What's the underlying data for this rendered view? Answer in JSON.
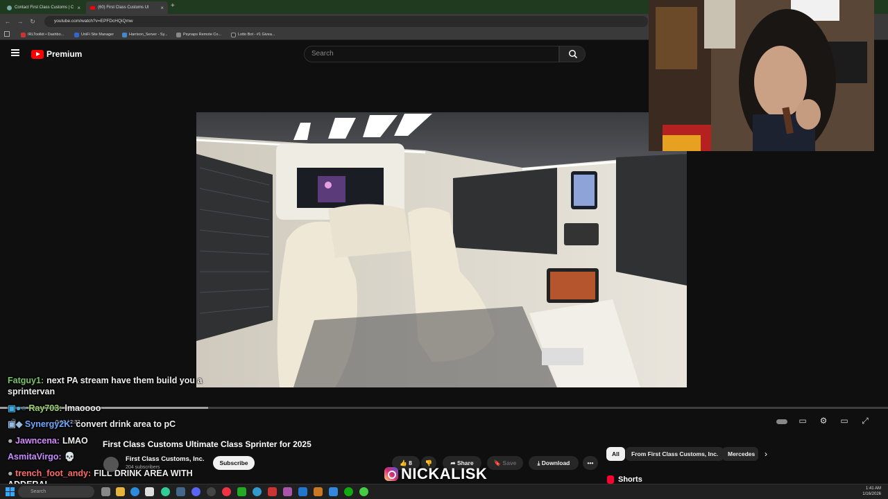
{
  "browser": {
    "tabs": [
      {
        "label": "Contact First Class Customs | C"
      },
      {
        "label": "(60) First Class Customs Ul"
      }
    ],
    "url": "youtube.com/watch?v=EPFDcHQiQmw",
    "bookmarks": [
      "IRLToolkit • Dashbo...",
      "UniFi Site Manager",
      "Harrison_Server - Sy...",
      "Psynaps Remote Co...",
      "Lotto Bot - #1 Givea..."
    ]
  },
  "header": {
    "logo_text": "Premium",
    "search_placeholder": "Search"
  },
  "player": {
    "time": "0:17 / 2:32"
  },
  "chat": [
    {
      "user": "Fatguy1:",
      "color": "#7cc36b",
      "message": "next PA stream have them build you a sprintervan"
    },
    {
      "user": "Ray703:",
      "color": "#9ad36a",
      "message": "lmaoooo"
    },
    {
      "user": "Synergy2K:",
      "color": "#6fa8ff",
      "message": "convert drink area to pC"
    },
    {
      "user": "Jawncena:",
      "color": "#d48cff",
      "message": "LMAO"
    },
    {
      "user": "AsmitaVirgo:",
      "color": "#c58cff",
      "message": "💀"
    },
    {
      "user": "trench_foot_andy:",
      "color": "#ff6b6b",
      "message": "FILL DRINK AREA WITH ADDERAL"
    }
  ],
  "video_info": {
    "title": "First Class Customs Ultimate Class Sprinter for 2025",
    "channel": "First Class Customs, Inc.",
    "subscribers": "204 subscribers",
    "subscribe_label": "Subscribe",
    "likes": "8",
    "share_label": "Share",
    "save_label": "Save",
    "download_label": "Download"
  },
  "chips": [
    "All",
    "From First Class Customs, Inc.",
    "Mercedes"
  ],
  "shorts_label": "Shorts",
  "watermark": "NICKALISK",
  "taskbar": {
    "search_placeholder": "Search",
    "time": "1:41 AM",
    "date": "1/16/2026"
  }
}
